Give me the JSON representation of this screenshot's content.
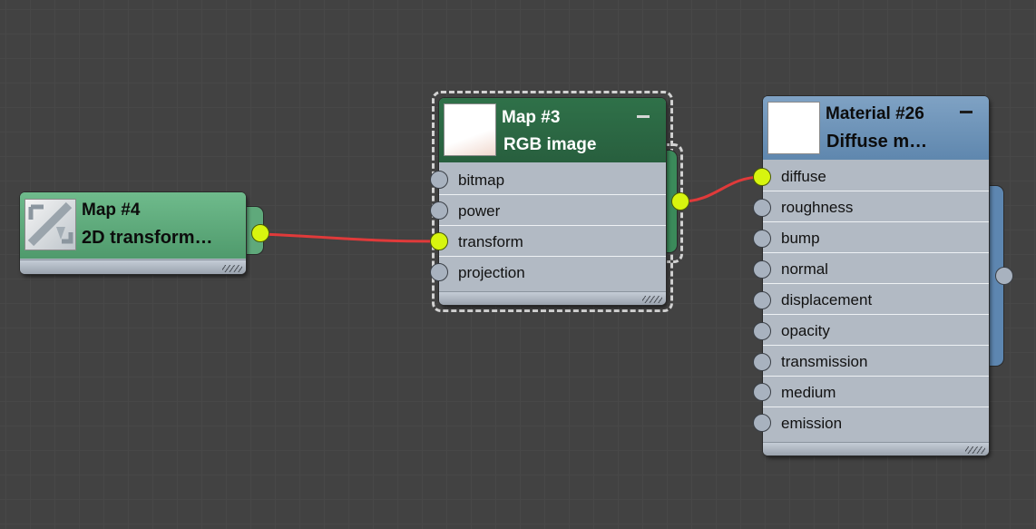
{
  "nodes": {
    "map4": {
      "title": "Map #4",
      "subtitle": "2D  transform…",
      "colors": {
        "header": "#5aa878",
        "ear": "#5fa97b"
      }
    },
    "map3": {
      "title": "Map #3",
      "subtitle": "RGB image",
      "inputs": [
        {
          "label": "bitmap",
          "connected": false
        },
        {
          "label": "power",
          "connected": false
        },
        {
          "label": "transform",
          "connected": true
        },
        {
          "label": "projection",
          "connected": false
        }
      ],
      "colors": {
        "header": "#2d6b45",
        "ear": "#3b8a5a"
      }
    },
    "material26": {
      "title": "Material #26",
      "subtitle": "Diffuse  m…",
      "inputs": [
        {
          "label": "diffuse",
          "connected": true
        },
        {
          "label": "roughness",
          "connected": false
        },
        {
          "label": "bump",
          "connected": false
        },
        {
          "label": "normal",
          "connected": false
        },
        {
          "label": "displacement",
          "connected": false
        },
        {
          "label": "opacity",
          "connected": false
        },
        {
          "label": "transmission",
          "connected": false
        },
        {
          "label": "medium",
          "connected": false
        },
        {
          "label": "emission",
          "connected": false
        }
      ],
      "colors": {
        "header": "#6d93b8",
        "ear": "#5d86b0"
      }
    }
  },
  "colors": {
    "canvas": "#424242",
    "wire": "#e03a3a",
    "port_active": "#d7f50f",
    "port_inactive": "#a8b2bf",
    "node_body": "#b2bac4"
  },
  "icons": {
    "map4_thumbnail": "transform-icon",
    "minimize": "minimize-icon",
    "resize": "resize-grip-icon"
  }
}
